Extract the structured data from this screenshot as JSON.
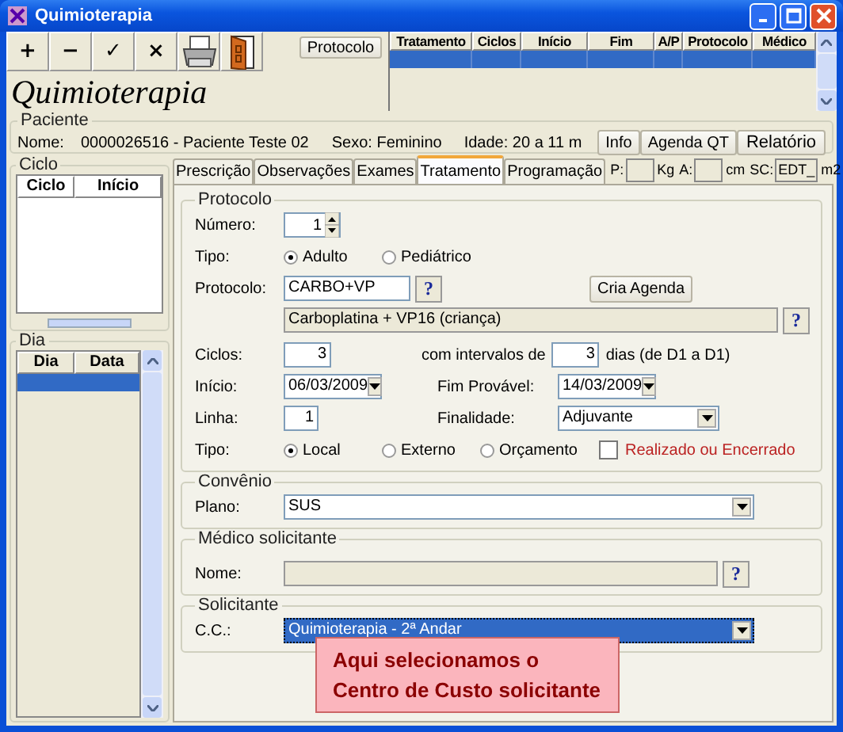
{
  "window": {
    "title": "Quimioterapia"
  },
  "toolbar": {
    "buttons": [
      {
        "kind": "text",
        "label": "+"
      },
      {
        "kind": "text",
        "label": "−"
      },
      {
        "kind": "text",
        "label": "✓"
      },
      {
        "kind": "text",
        "label": "×"
      },
      {
        "kind": "printer"
      },
      {
        "kind": "door"
      }
    ],
    "protocol_button": "Protocolo"
  },
  "heading": "Quimioterapia",
  "treatments_table": {
    "columns": [
      "Tratamento",
      "Ciclos",
      "Início",
      "Fim",
      "A/P",
      "Protocolo",
      "Médico"
    ],
    "rows": [
      {
        "selected": true
      }
    ]
  },
  "patient": {
    "legend": "Paciente",
    "name_label": "Nome:",
    "name_value": "0000026516 - Paciente Teste 02",
    "sex": "Sexo: Feminino",
    "age": "Idade: 20 a 11 m",
    "buttons": [
      "Info",
      "Agenda QT",
      "Relatório"
    ]
  },
  "cycle": {
    "legend": "Ciclo",
    "columns": [
      "Ciclo",
      "Início"
    ]
  },
  "day": {
    "legend": "Dia",
    "columns": [
      "Dia",
      "Data"
    ],
    "rows": [
      {
        "selected": true
      }
    ]
  },
  "tabs": [
    {
      "label": "Prescrição",
      "selected": false
    },
    {
      "label": "Observações",
      "selected": false
    },
    {
      "label": "Exames",
      "selected": false
    },
    {
      "label": "Tratamento",
      "selected": true
    },
    {
      "label": "Programação",
      "selected": false
    }
  ],
  "measures": [
    {
      "label": "P:",
      "unit": "Kg"
    },
    {
      "label": "A:",
      "unit": "cm"
    },
    {
      "label": "SC:",
      "value": "EDT_",
      "unit": "m2"
    }
  ],
  "protocol": {
    "legend": "Protocolo",
    "number_label": "Número:",
    "number_value": "1",
    "type_label": "Tipo:",
    "type_options": [
      {
        "label": "Adulto",
        "selected": true
      },
      {
        "label": "Pediátrico",
        "selected": false
      }
    ],
    "protocol_label": "Protocolo:",
    "protocol_value": "CARBO+VP",
    "help": "?",
    "create_button": "Cria Agenda",
    "description": "Carboplatina + VP16 (criança)",
    "description_help": "?",
    "cycles_label": "Ciclos:",
    "cycles_value": "3",
    "interval_label": "com intervalos de",
    "interval_value": "3",
    "interval_suffix": "dias (de D1 a D1)",
    "start_label": "Início:",
    "start_value": "06/03/2009",
    "end_label": "Fim Provável:",
    "end_value": "14/03/2009",
    "line_label": "Linha:",
    "line_value": "1",
    "purpose_label": "Finalidade:",
    "purpose_value": "Adjuvante",
    "place_label": "Tipo:",
    "place_options": [
      {
        "label": "Local",
        "selected": true
      },
      {
        "label": "Externo",
        "selected": false
      },
      {
        "label": "Orçamento",
        "selected": false
      }
    ],
    "done": {
      "label": "Realizado ou Encerrado",
      "checked": false
    }
  },
  "agreement": {
    "legend": "Convênio",
    "label": "Plano:",
    "value": "SUS"
  },
  "doctor": {
    "legend": "Médico solicitante",
    "label": "Nome:",
    "help": "?"
  },
  "requester": {
    "legend": "Solicitante",
    "label": "C.C.:",
    "value": "Quimioterapia - 2ª Andar"
  },
  "callout": "Aqui selecionamos o Centro de Custo solicitante"
}
